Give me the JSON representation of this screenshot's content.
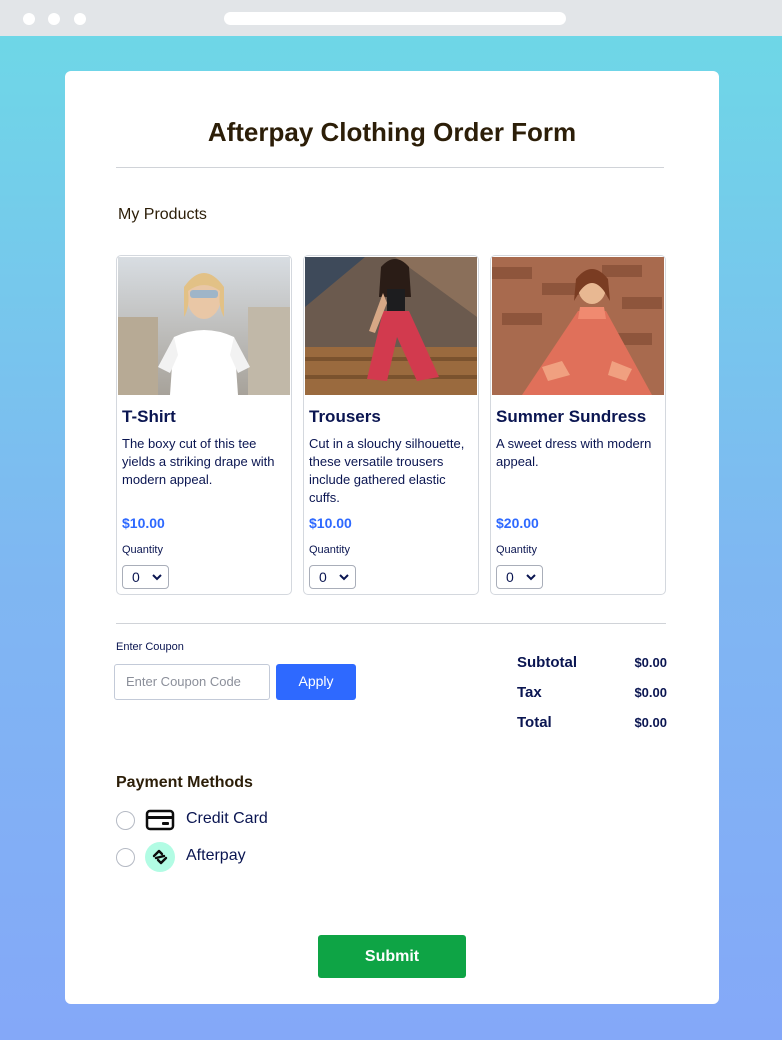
{
  "form": {
    "title": "Afterpay Clothing Order Form",
    "products_heading": "My Products",
    "products": [
      {
        "name": "T-Shirt",
        "description": "The boxy cut of this tee yields a striking drape with modern appeal.",
        "price": "$10.00",
        "quantity_label": "Quantity",
        "quantity": "0"
      },
      {
        "name": "Trousers",
        "description": "Cut in a slouchy silhouette, these versatile trousers include gathered elastic cuffs.",
        "price": "$10.00",
        "quantity_label": "Quantity",
        "quantity": "0"
      },
      {
        "name": "Summer Sundress",
        "description": "A sweet dress with modern appeal.",
        "price": "$20.00",
        "quantity_label": "Quantity",
        "quantity": "0"
      }
    ],
    "coupon": {
      "label": "Enter Coupon",
      "placeholder": "Enter Coupon Code",
      "apply_label": "Apply"
    },
    "totals": {
      "subtotal_label": "Subtotal",
      "subtotal_value": "$0.00",
      "tax_label": "Tax",
      "tax_value": "$0.00",
      "total_label": "Total",
      "total_value": "$0.00"
    },
    "payment": {
      "heading": "Payment Methods",
      "methods": [
        {
          "label": "Credit Card",
          "icon": "credit-card-icon"
        },
        {
          "label": "Afterpay",
          "icon": "afterpay-icon"
        }
      ]
    },
    "submit_label": "Submit"
  },
  "colors": {
    "accent_blue": "#2e69ff",
    "submit_green": "#0ea445",
    "text_navy": "#0a1551",
    "afterpay_mint": "#b2fce4"
  }
}
